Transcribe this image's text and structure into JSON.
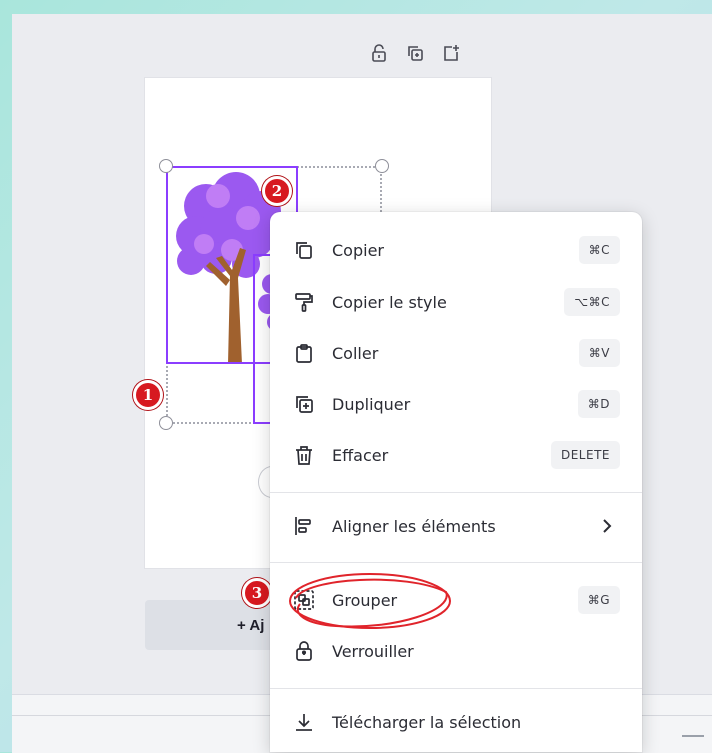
{
  "badges": {
    "one": "1",
    "two": "2",
    "three": "3"
  },
  "page": {
    "add_page_label": "+ Aj"
  },
  "page_tools": [
    "lock-icon",
    "duplicate-page-icon",
    "add-page-icon"
  ],
  "colors": {
    "selection": "#8b3dff",
    "badge": "#d71920",
    "annotation": "#e0242b"
  },
  "context_menu": {
    "items": [
      {
        "icon": "copy-icon",
        "label": "Copier",
        "shortcut": "⌘C"
      },
      {
        "icon": "paint-roller-icon",
        "label": "Copier le style",
        "shortcut": "⌥⌘C"
      },
      {
        "icon": "clipboard-icon",
        "label": "Coller",
        "shortcut": "⌘V"
      },
      {
        "icon": "duplicate-icon",
        "label": "Dupliquer",
        "shortcut": "⌘D"
      },
      {
        "icon": "trash-icon",
        "label": "Effacer",
        "shortcut": "DELETE"
      }
    ],
    "align": {
      "icon": "align-icon",
      "label": "Aligner les éléments"
    },
    "group": {
      "icon": "group-icon",
      "label": "Grouper",
      "shortcut": "⌘G"
    },
    "lock": {
      "icon": "lock-icon",
      "label": "Verrouiller"
    },
    "download": {
      "icon": "download-icon",
      "label": "Télécharger la sélection"
    }
  }
}
